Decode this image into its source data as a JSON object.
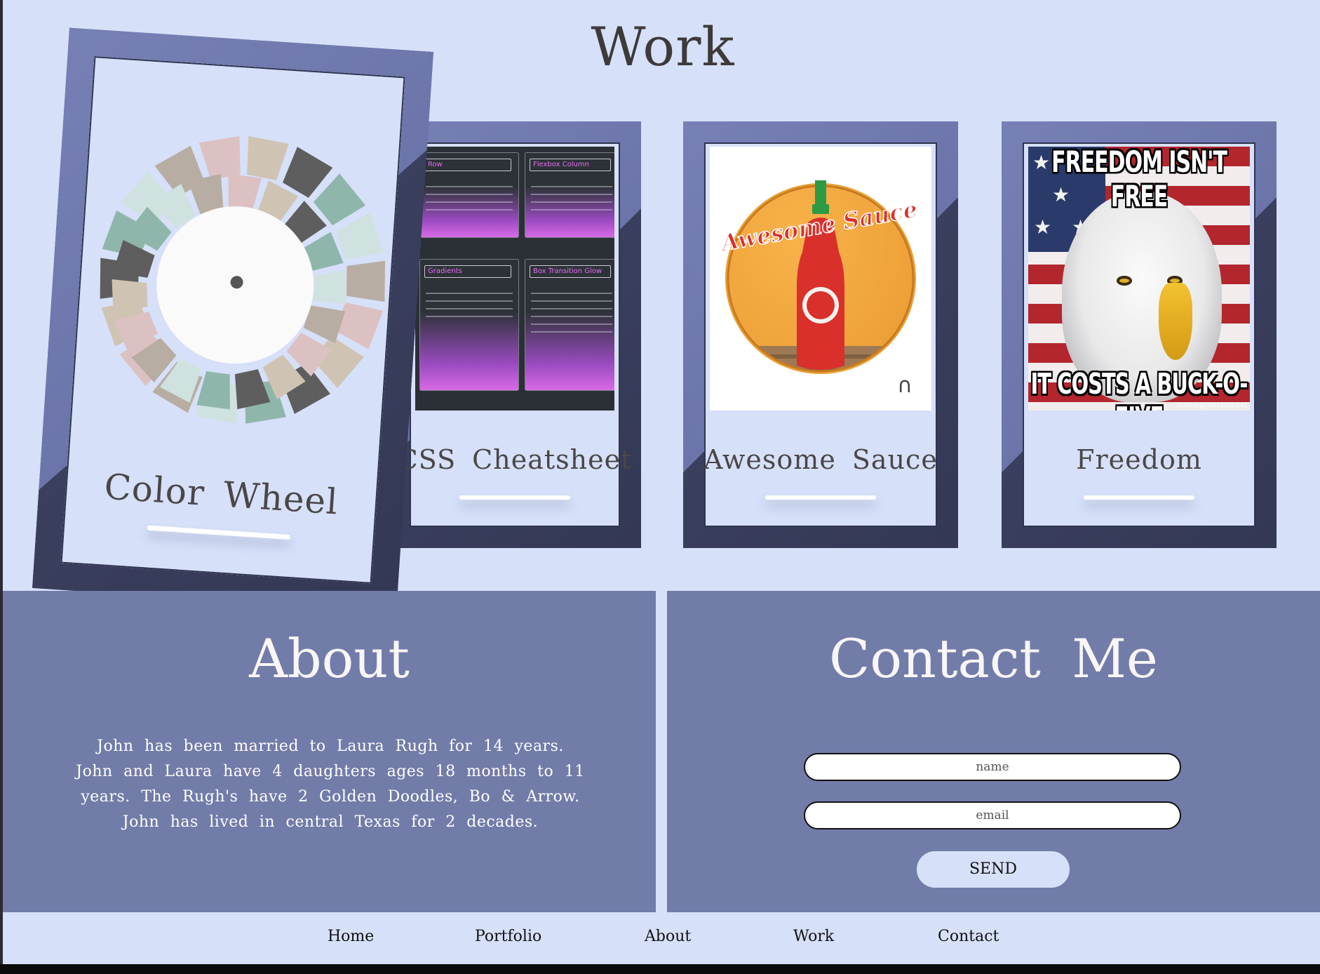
{
  "work": {
    "title": "Work",
    "cards": [
      {
        "label": "Color Wheel"
      },
      {
        "label": "CSS Cheatsheet",
        "panels": [
          "Row",
          "Flexbox Column",
          "Gradients",
          "Box Transition Glow"
        ]
      },
      {
        "label": "Awesome Sauce",
        "image_text": "Awesome Sauce"
      },
      {
        "label": "Freedom",
        "meme_top": "FREEDOM ISN'T FREE",
        "meme_bottom": "IT COSTS A BUCK-O-FIVE",
        "meme_credit": "memegenerator.net"
      }
    ]
  },
  "about": {
    "title": "About",
    "text": "John has been married to Laura Rugh for 14 years. John and Laura have 4 daughters ages 18 months to 11 years. The Rugh's have 2 Golden Doodles, Bo & Arrow. John has lived in central Texas for 2 decades."
  },
  "contact": {
    "title": "Contact Me",
    "name_placeholder": "name",
    "email_placeholder": "email",
    "send_label": "SEND"
  },
  "nav": [
    "Home",
    "Portfolio",
    "About",
    "Work",
    "Contact"
  ],
  "colors": {
    "background": "#d6e0f8",
    "section": "#727ca9",
    "frame_light": "#7780b5",
    "frame_dark": "#3a3f5e"
  }
}
